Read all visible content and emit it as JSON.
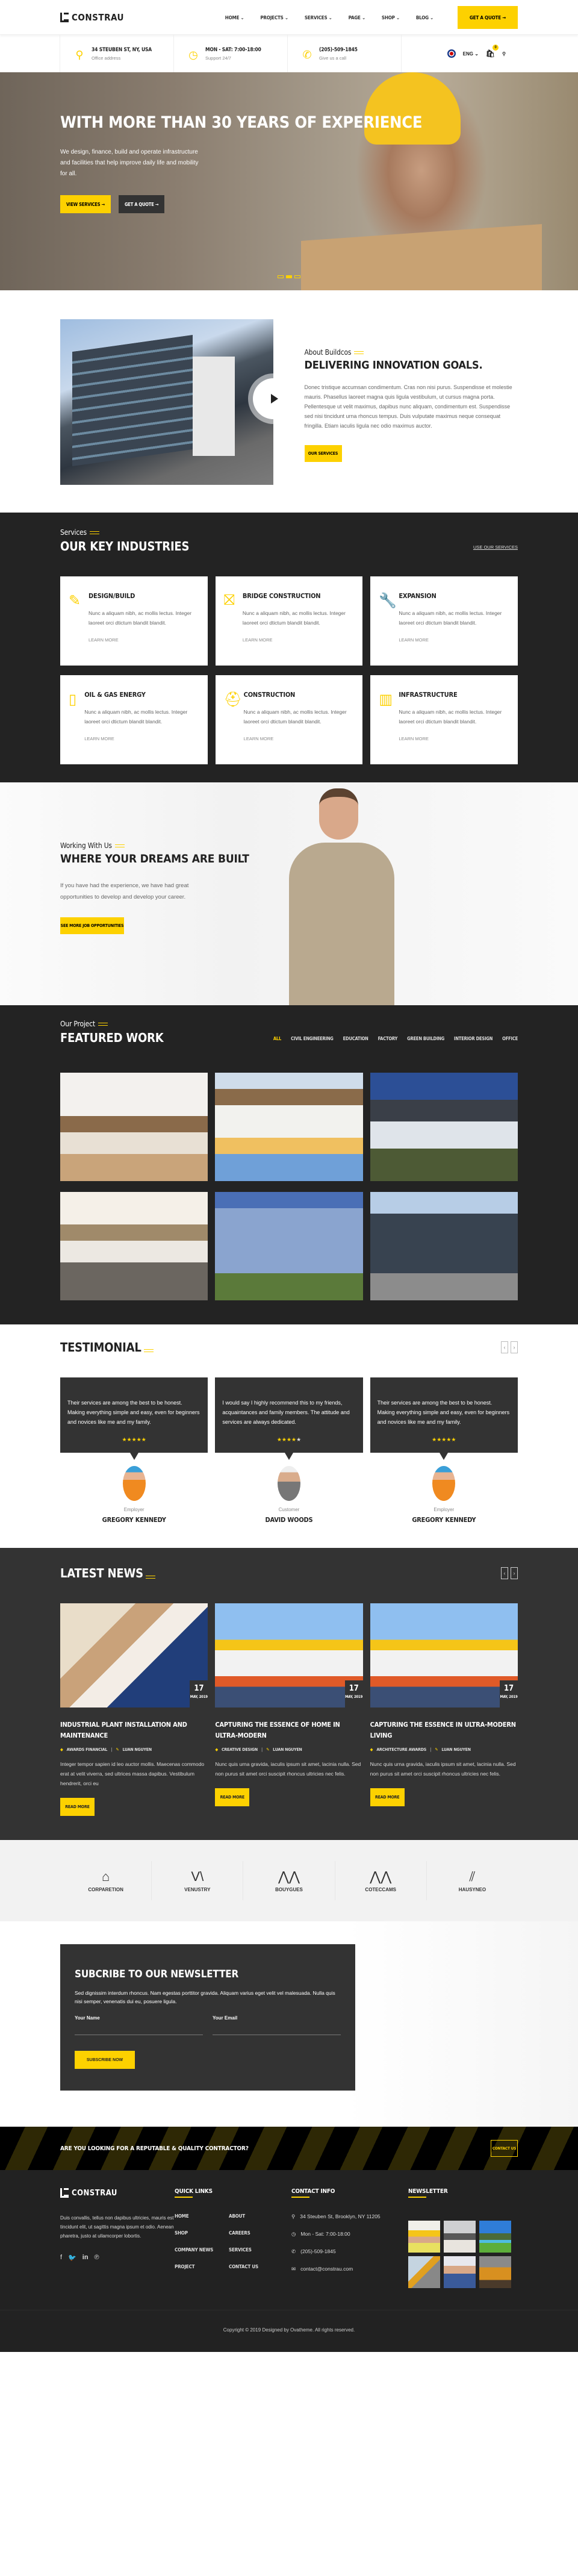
{
  "brand": {
    "name": "CONSTRAU",
    "accent": "#fdd100",
    "dark": "#232323"
  },
  "nav": {
    "items": [
      {
        "label": "HOME ⌄"
      },
      {
        "label": "PROJECTS ⌄"
      },
      {
        "label": "SERVICES ⌄"
      },
      {
        "label": "PAGE ⌄"
      },
      {
        "label": "SHOP ⌄"
      },
      {
        "label": "BLOG ⌄"
      }
    ],
    "quote_button": "GET A QUOTE →"
  },
  "info_bar": {
    "items": [
      {
        "icon": "map-pin-icon",
        "title": "34 STEUBEN ST, NY, USA",
        "sub": "Office address"
      },
      {
        "icon": "clock-icon",
        "title": "MON - SAT: 7:00-18:00",
        "sub": "Support 24/7"
      },
      {
        "icon": "phone-icon",
        "title": "(205)-509-1845",
        "sub": "Give us a call"
      }
    ],
    "language": "ENG ⌄",
    "cart_count": "0"
  },
  "hero": {
    "title": "WITH MORE THAN 30 YEARS OF EXPERIENCE",
    "text": "We design, finance, build and operate infrastructure and facilities that help improve daily life and mobility for all.",
    "primary_button": "VIEW SERVICES →",
    "secondary_button": "GET A QUOTE →",
    "slide_count": 3,
    "active_slide": 2
  },
  "about": {
    "kicker": "About Buildcos",
    "title": "DELIVERING INNOVATION GOALS.",
    "text": "Donec tristique accumsan condimentum. Cras non nisi purus. Suspendisse et molestie mauris. Phasellus laoreet magna quis ligula vestibulum, ut cursus magna porta. Pellentesque ut velit maximus, dapibus nunc aliquam, condimentum est. Suspendisse sed nisi tincidunt urna rhoncus tempus. Duis vulputate maximus neque consequat fringilla. Etiam iaculis ligula nec odio maximus auctor.",
    "button": "OUR SERVICES"
  },
  "services": {
    "kicker": "Services",
    "title": "OUR KEY INDUSTRIES",
    "link": "USE OUR SERVICES",
    "items": [
      {
        "icon": "ruler-pencil-icon",
        "title": "DESIGN/BUILD",
        "text": "Nunc a aliquam nibh, ac mollis lectus. Integer laoreet orci dtictum blandit blandit.",
        "link": "LEARN MORE"
      },
      {
        "icon": "barrier-icon",
        "title": "BRIDGE CONSTRUCTION",
        "text": "Nunc a aliquam nibh, ac mollis lectus. Integer laoreet orci dtictum blandit blandit.",
        "link": "LEARN MORE"
      },
      {
        "icon": "wrench-hand-icon",
        "title": "EXPANSION",
        "text": "Nunc a aliquam nibh, ac mollis lectus. Integer laoreet orci dtictum blandit blandit.",
        "link": "LEARN MORE"
      },
      {
        "icon": "spray-can-icon",
        "title": "OIL & GAS ENERGY",
        "text": "Nunc a aliquam nibh, ac mollis lectus. Integer laoreet orci dtictum blandit blandit.",
        "link": "LEARN MORE"
      },
      {
        "icon": "worker-icon",
        "title": "CONSTRUCTION",
        "text": "Nunc a aliquam nibh, ac mollis lectus. Integer laoreet orci dtictum blandit blandit.",
        "link": "LEARN MORE"
      },
      {
        "icon": "buildings-icon",
        "title": "INFRASTRUCTURE",
        "text": "Nunc a aliquam nibh, ac mollis lectus. Integer laoreet orci dtictum blandit blandit.",
        "link": "LEARN MORE"
      }
    ]
  },
  "working": {
    "kicker": "Working With Us",
    "title": "WHERE YOUR DREAMS ARE BUILT",
    "text": "If you have had the experience, we have had great opportunities to develop and develop your career.",
    "button": "SEE MORE JOB OPPORTUNITIES"
  },
  "featured": {
    "kicker": "Our Project",
    "title": "FEATURED WORK",
    "filters": [
      "ALL",
      "CIVIL ENGINEERING",
      "EDUCATION",
      "FACTORY",
      "GREEN BUILDING",
      "INTERIOR DESIGN",
      "OFFICE"
    ],
    "active_filter": "ALL",
    "projects": [
      {
        "alt": "Modern living room interior"
      },
      {
        "alt": "House with pool"
      },
      {
        "alt": "Modern villa at dusk"
      },
      {
        "alt": "Lounge interior"
      },
      {
        "alt": "Curved glass office building"
      },
      {
        "alt": "Office building"
      }
    ]
  },
  "testimonial": {
    "title": "TESTIMONIAL",
    "items": [
      {
        "quote": "Their services are among the best to be honest. Making everything simple and easy, even for beginners and novices like me and my family.",
        "rating": 5,
        "role": "Employer",
        "name": "GREGORY KENNEDY"
      },
      {
        "quote": "I would say I highly recommend this to my friends, acquaintances and family members. The attitude and services are always dedicated.",
        "rating": 4,
        "role": "Customer",
        "name": "DAVID WOODS"
      },
      {
        "quote": "Their services are among the best to be honest. Making everything simple and easy, even for beginners and novices like me and my family.",
        "rating": 5,
        "role": "Employer",
        "name": "GREGORY KENNEDY"
      }
    ]
  },
  "news": {
    "title": "LATEST NEWS",
    "items": [
      {
        "day": "17",
        "month": "MAY, 2019",
        "title": "INDUSTRIAL PLANT INSTALLATION AND MAINTENANCE",
        "tags": "AWARDS  FINANCIAL",
        "author": "LUAN NGUYEN",
        "text": "Integer tempor sapien id leo auctor mollis. Maecenas commodo erat at velit viverra, sed ultrices massa dapibus. Vestibulum hendrerit, orci eu",
        "button": "READ MORE"
      },
      {
        "day": "17",
        "month": "MAY, 2019",
        "title": "CAPTURING THE ESSENCE OF HOME IN ULTRA-MODERN",
        "tags": "CREATIVE DESIGN",
        "author": "LUAN NGUYEN",
        "text": "Nunc quis urna gravida, iaculis ipsum sit amet, lacinia nulla. Sed non purus sit amet orci suscipit rhoncus ultricies nec felis.",
        "button": "READ MORE"
      },
      {
        "day": "17",
        "month": "MAY, 2019",
        "title": "CAPTURING THE ESSENCE IN ULTRA-MODERN LIVING",
        "tags": "ARCHITECTURE  AWARDS",
        "author": "LUAN NGUYEN",
        "text": "Nunc quis urna gravida, iaculis ipsum sit amet, lacinia nulla. Sed non purus sit amet orci suscipit rhoncus ultricies nec felis.",
        "button": "READ MORE"
      }
    ]
  },
  "partners": [
    {
      "name": "CORPARETION",
      "mark": "⌂"
    },
    {
      "name": "VENUSTRY",
      "mark": "V\\"
    },
    {
      "name": "BOUYGUES",
      "mark": "⋀⋀"
    },
    {
      "name": "COTECCAMS",
      "mark": "⋀⋀"
    },
    {
      "name": "HAUSYNEO",
      "mark": "⫽"
    }
  ],
  "newsletter": {
    "title": "SUBCRIBE TO OUR NEWSLETTER",
    "text": "Sed dignissim interdum rhoncus. Nam egestas porttitor gravida. Aliquam varius eget velit vel malesuada. Nulla quis nisi semper, venenatis dui eu, posuere ligula.",
    "name_label": "Your Name",
    "email_label": "Your Email",
    "name_value": "",
    "email_value": "",
    "button": "SUBSCRIBE NOW"
  },
  "cta": {
    "text": "ARE YOU LOOKING FOR A REPUTABLE & QUALITY CONTRACTOR?",
    "button": "CONTACT US"
  },
  "footer": {
    "about": "Duis convallis, tellus non dapibus ultricies, mauris est tincidunt elit, ut sagittis magna ipsum et odio. Aenean pharetra, justo at ullamcorper lobortis.",
    "social": [
      "facebook-icon",
      "twitter-icon",
      "linkedin-icon",
      "pinterest-icon"
    ],
    "quick_links_title": "QUICK LINKS",
    "quick_links": [
      "HOME",
      "ABOUT",
      "SHOP",
      "CAREERS",
      "COMPANY NEWS",
      "SERVICES",
      "PROJECT",
      "CONTACT US"
    ],
    "contact_title": "CONTACT INFO",
    "contact": [
      {
        "icon": "map-pin-icon",
        "glyph": "⚲",
        "text": "34 Steuben St, Brooklyn, NY 11205"
      },
      {
        "icon": "clock-icon",
        "glyph": "◷",
        "text": "Mon - Sat: 7:00-18:00"
      },
      {
        "icon": "phone-icon",
        "glyph": "✆",
        "text": "(205)-509-1845"
      },
      {
        "icon": "mail-icon",
        "glyph": "✉",
        "text": "contact@constrau.com"
      }
    ],
    "newsletter_title": "NEWSLETTER",
    "copyright": "Copyright © 2019 Designed by Ovatheme. All rights reserved."
  }
}
